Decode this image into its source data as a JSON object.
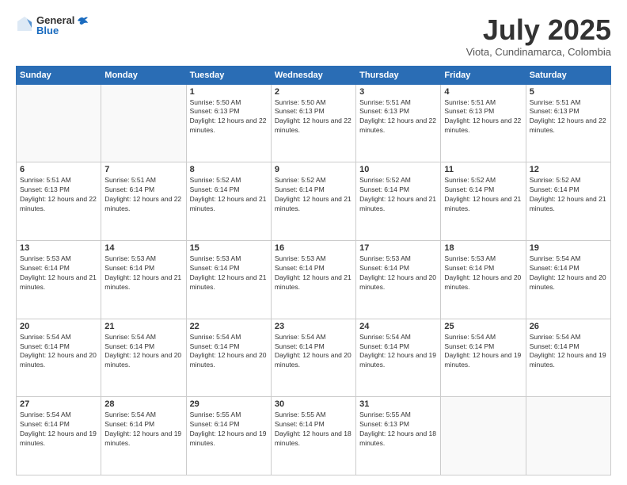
{
  "header": {
    "logo": {
      "line1": "General",
      "line2": "Blue"
    },
    "title": "July 2025",
    "subtitle": "Viota, Cundinamarca, Colombia"
  },
  "days_of_week": [
    "Sunday",
    "Monday",
    "Tuesday",
    "Wednesday",
    "Thursday",
    "Friday",
    "Saturday"
  ],
  "weeks": [
    [
      {
        "day": "",
        "empty": true
      },
      {
        "day": "",
        "empty": true
      },
      {
        "day": "1",
        "sunrise": "5:50 AM",
        "sunset": "6:13 PM",
        "daylight": "12 hours and 22 minutes."
      },
      {
        "day": "2",
        "sunrise": "5:50 AM",
        "sunset": "6:13 PM",
        "daylight": "12 hours and 22 minutes."
      },
      {
        "day": "3",
        "sunrise": "5:51 AM",
        "sunset": "6:13 PM",
        "daylight": "12 hours and 22 minutes."
      },
      {
        "day": "4",
        "sunrise": "5:51 AM",
        "sunset": "6:13 PM",
        "daylight": "12 hours and 22 minutes."
      },
      {
        "day": "5",
        "sunrise": "5:51 AM",
        "sunset": "6:13 PM",
        "daylight": "12 hours and 22 minutes."
      }
    ],
    [
      {
        "day": "6",
        "sunrise": "5:51 AM",
        "sunset": "6:13 PM",
        "daylight": "12 hours and 22 minutes."
      },
      {
        "day": "7",
        "sunrise": "5:51 AM",
        "sunset": "6:14 PM",
        "daylight": "12 hours and 22 minutes."
      },
      {
        "day": "8",
        "sunrise": "5:52 AM",
        "sunset": "6:14 PM",
        "daylight": "12 hours and 21 minutes."
      },
      {
        "day": "9",
        "sunrise": "5:52 AM",
        "sunset": "6:14 PM",
        "daylight": "12 hours and 21 minutes."
      },
      {
        "day": "10",
        "sunrise": "5:52 AM",
        "sunset": "6:14 PM",
        "daylight": "12 hours and 21 minutes."
      },
      {
        "day": "11",
        "sunrise": "5:52 AM",
        "sunset": "6:14 PM",
        "daylight": "12 hours and 21 minutes."
      },
      {
        "day": "12",
        "sunrise": "5:52 AM",
        "sunset": "6:14 PM",
        "daylight": "12 hours and 21 minutes."
      }
    ],
    [
      {
        "day": "13",
        "sunrise": "5:53 AM",
        "sunset": "6:14 PM",
        "daylight": "12 hours and 21 minutes."
      },
      {
        "day": "14",
        "sunrise": "5:53 AM",
        "sunset": "6:14 PM",
        "daylight": "12 hours and 21 minutes."
      },
      {
        "day": "15",
        "sunrise": "5:53 AM",
        "sunset": "6:14 PM",
        "daylight": "12 hours and 21 minutes."
      },
      {
        "day": "16",
        "sunrise": "5:53 AM",
        "sunset": "6:14 PM",
        "daylight": "12 hours and 21 minutes."
      },
      {
        "day": "17",
        "sunrise": "5:53 AM",
        "sunset": "6:14 PM",
        "daylight": "12 hours and 20 minutes."
      },
      {
        "day": "18",
        "sunrise": "5:53 AM",
        "sunset": "6:14 PM",
        "daylight": "12 hours and 20 minutes."
      },
      {
        "day": "19",
        "sunrise": "5:54 AM",
        "sunset": "6:14 PM",
        "daylight": "12 hours and 20 minutes."
      }
    ],
    [
      {
        "day": "20",
        "sunrise": "5:54 AM",
        "sunset": "6:14 PM",
        "daylight": "12 hours and 20 minutes."
      },
      {
        "day": "21",
        "sunrise": "5:54 AM",
        "sunset": "6:14 PM",
        "daylight": "12 hours and 20 minutes."
      },
      {
        "day": "22",
        "sunrise": "5:54 AM",
        "sunset": "6:14 PM",
        "daylight": "12 hours and 20 minutes."
      },
      {
        "day": "23",
        "sunrise": "5:54 AM",
        "sunset": "6:14 PM",
        "daylight": "12 hours and 20 minutes."
      },
      {
        "day": "24",
        "sunrise": "5:54 AM",
        "sunset": "6:14 PM",
        "daylight": "12 hours and 19 minutes."
      },
      {
        "day": "25",
        "sunrise": "5:54 AM",
        "sunset": "6:14 PM",
        "daylight": "12 hours and 19 minutes."
      },
      {
        "day": "26",
        "sunrise": "5:54 AM",
        "sunset": "6:14 PM",
        "daylight": "12 hours and 19 minutes."
      }
    ],
    [
      {
        "day": "27",
        "sunrise": "5:54 AM",
        "sunset": "6:14 PM",
        "daylight": "12 hours and 19 minutes."
      },
      {
        "day": "28",
        "sunrise": "5:54 AM",
        "sunset": "6:14 PM",
        "daylight": "12 hours and 19 minutes."
      },
      {
        "day": "29",
        "sunrise": "5:55 AM",
        "sunset": "6:14 PM",
        "daylight": "12 hours and 19 minutes."
      },
      {
        "day": "30",
        "sunrise": "5:55 AM",
        "sunset": "6:14 PM",
        "daylight": "12 hours and 18 minutes."
      },
      {
        "day": "31",
        "sunrise": "5:55 AM",
        "sunset": "6:13 PM",
        "daylight": "12 hours and 18 minutes."
      },
      {
        "day": "",
        "empty": true
      },
      {
        "day": "",
        "empty": true
      }
    ]
  ]
}
